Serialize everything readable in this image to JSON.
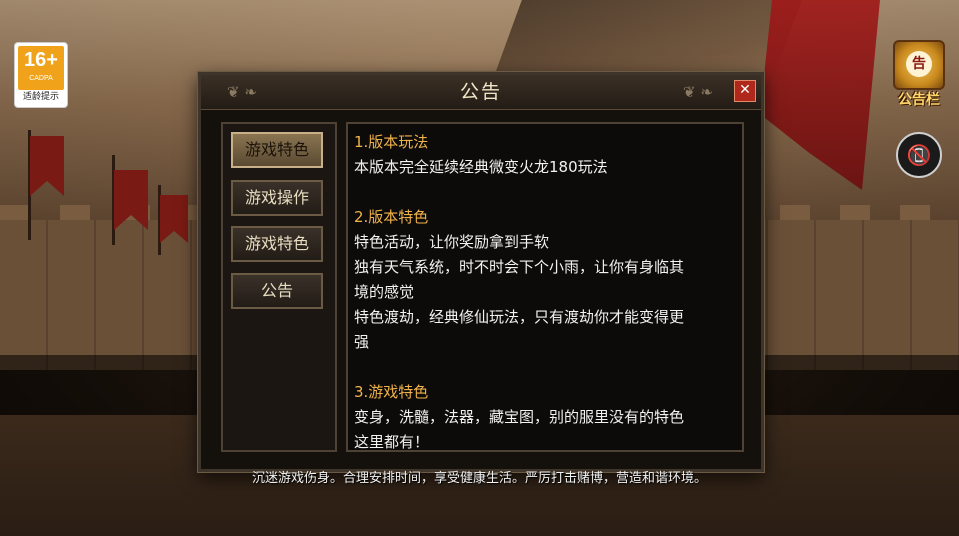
{
  "age_badge": {
    "rating": "16+",
    "org": "CADPA",
    "tip": "适龄提示"
  },
  "right_icons": {
    "notice_label": "公告栏",
    "notice_seal": "告",
    "phone_icon": "phone-off-icon"
  },
  "dialog": {
    "title": "公告",
    "close_icon": "close-icon",
    "ornament_left": "❦ ❧",
    "ornament_right": "❦ ❧",
    "tabs": [
      {
        "label": "游戏特色",
        "active": true
      },
      {
        "label": "游戏操作",
        "active": false
      },
      {
        "label": "游戏特色",
        "active": false
      },
      {
        "label": "公告",
        "active": false
      }
    ],
    "content": {
      "sections": [
        {
          "title": "1.版本玩法",
          "lines": [
            "本版本完全延续经典微变火龙180玩法"
          ]
        },
        {
          "title": "2.版本特色",
          "lines": [
            "特色活动，让你奖励拿到手软",
            "独有天气系统，时不时会下个小雨，让你有身临其",
            "境的感觉",
            "特色渡劫，经典修仙玩法，只有渡劫你才能变得更",
            "强"
          ]
        },
        {
          "title": "3.游戏特色",
          "lines": [
            "变身，洗髓，法器，藏宝图，别的服里没有的特色",
            "这里都有！"
          ]
        }
      ]
    }
  },
  "footer_notice": "沉迷游戏伤身。合理安排时间，享受健康生活。严厉打击赌博，营造和谐环境。",
  "colors": {
    "section_title": "#f0b24a",
    "body_text": "#f2f2f2",
    "close_button": "#b0281c",
    "age_badge": "#f0a21a"
  }
}
